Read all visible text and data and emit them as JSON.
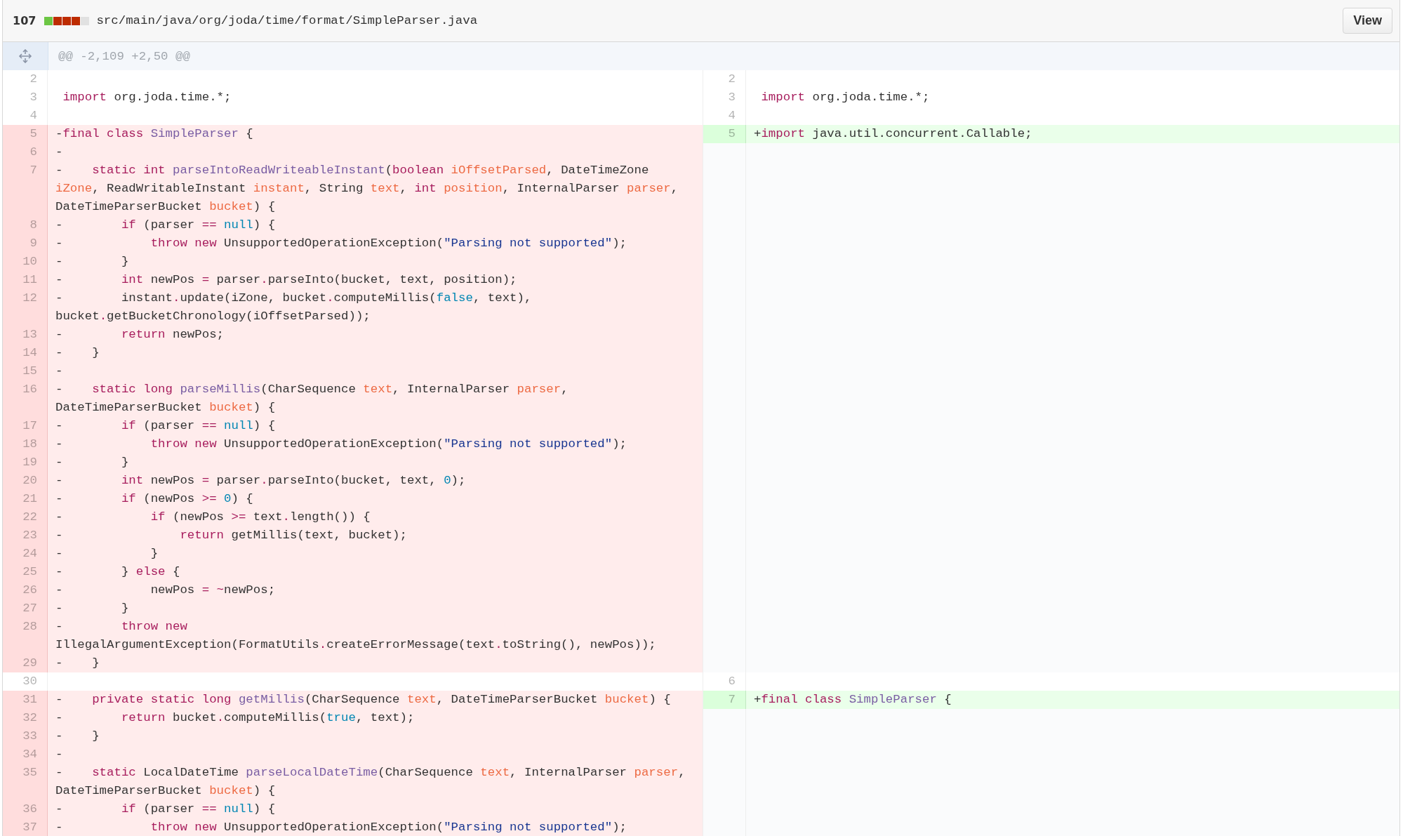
{
  "file_header": {
    "change_count": "107",
    "diffstat": [
      {
        "color": "#6cc644"
      },
      {
        "color": "#bd2c00"
      },
      {
        "color": "#bd2c00"
      },
      {
        "color": "#bd2c00"
      },
      {
        "color": "#e1e1e1"
      }
    ],
    "path": "src/main/java/org/joda/time/format/SimpleParser.java",
    "view_button": "View"
  },
  "hunk": {
    "header": "@@ -2,109 +2,50 @@"
  },
  "rows": [
    {
      "left": {
        "num": "2",
        "kind": "context"
      },
      "right": {
        "num": "2",
        "kind": "context"
      }
    },
    {
      "left": {
        "num": "3",
        "kind": "context",
        "tokens": [
          {
            "kind": "kw",
            "text": " import"
          },
          {
            "kind": "plain",
            "text": " org.joda.time.*;"
          }
        ]
      },
      "right": {
        "num": "3",
        "kind": "context",
        "tokens": [
          {
            "kind": "kw",
            "text": " import"
          },
          {
            "kind": "plain",
            "text": " org.joda.time.*;"
          }
        ]
      }
    },
    {
      "left": {
        "num": "4",
        "kind": "context"
      },
      "right": {
        "num": "4",
        "kind": "context"
      }
    },
    {
      "left": {
        "num": "5",
        "kind": "deleted",
        "tokens": [
          {
            "kind": "plain",
            "text": "-"
          },
          {
            "kind": "kw",
            "text": "final"
          },
          {
            "kind": "kw",
            "text": " class"
          },
          {
            "kind": "fn",
            "text": " SimpleParser"
          },
          {
            "kind": "plain",
            "text": " {"
          }
        ]
      },
      "right": {
        "num": "5",
        "kind": "added",
        "tokens": [
          {
            "kind": "plain",
            "text": "+"
          },
          {
            "kind": "kw",
            "text": "import"
          },
          {
            "kind": "plain",
            "text": " java.util.concurrent.Callable;"
          }
        ]
      }
    },
    {
      "left": {
        "num": "6",
        "kind": "deleted",
        "tokens": [
          {
            "kind": "plain",
            "text": "-"
          }
        ]
      }
    },
    {
      "left": {
        "num": "7",
        "kind": "deleted",
        "tokens": [
          {
            "kind": "plain",
            "text": "-    "
          },
          {
            "kind": "kw",
            "text": "static"
          },
          {
            "kind": "kw",
            "text": " int"
          },
          {
            "kind": "fn",
            "text": " parseIntoReadWriteableInstant"
          },
          {
            "kind": "plain",
            "text": "("
          },
          {
            "kind": "kw",
            "text": "boolean"
          },
          {
            "kind": "param",
            "text": " iOffsetParsed"
          },
          {
            "kind": "plain",
            "text": ", DateTimeZone "
          },
          {
            "kind": "param",
            "text": "iZone"
          },
          {
            "kind": "plain",
            "text": ", ReadWritableInstant "
          },
          {
            "kind": "param",
            "text": "instant"
          },
          {
            "kind": "plain",
            "text": ", String "
          },
          {
            "kind": "param",
            "text": "text"
          },
          {
            "kind": "plain",
            "text": ", "
          },
          {
            "kind": "kw",
            "text": "int"
          },
          {
            "kind": "param",
            "text": " position"
          },
          {
            "kind": "plain",
            "text": ", InternalParser "
          },
          {
            "kind": "param",
            "text": "parser"
          },
          {
            "kind": "plain",
            "text": ", DateTimeParserBucket "
          },
          {
            "kind": "param",
            "text": "bucket"
          },
          {
            "kind": "plain",
            "text": ") {"
          }
        ]
      }
    },
    {
      "left": {
        "num": "8",
        "kind": "deleted",
        "tokens": [
          {
            "kind": "plain",
            "text": "-        "
          },
          {
            "kind": "kw",
            "text": "if"
          },
          {
            "kind": "plain",
            "text": " (parser "
          },
          {
            "kind": "kw",
            "text": "=="
          },
          {
            "kind": "const",
            "text": " null"
          },
          {
            "kind": "plain",
            "text": ") {"
          }
        ]
      }
    },
    {
      "left": {
        "num": "9",
        "kind": "deleted",
        "tokens": [
          {
            "kind": "plain",
            "text": "-            "
          },
          {
            "kind": "kw",
            "text": "throw"
          },
          {
            "kind": "kw",
            "text": " new"
          },
          {
            "kind": "plain",
            "text": " UnsupportedOperationException("
          },
          {
            "kind": "str",
            "text": "\"Parsing not supported\""
          },
          {
            "kind": "plain",
            "text": ");"
          }
        ]
      }
    },
    {
      "left": {
        "num": "10",
        "kind": "deleted",
        "tokens": [
          {
            "kind": "plain",
            "text": "-        }"
          }
        ]
      }
    },
    {
      "left": {
        "num": "11",
        "kind": "deleted",
        "tokens": [
          {
            "kind": "plain",
            "text": "-        "
          },
          {
            "kind": "kw",
            "text": "int"
          },
          {
            "kind": "plain",
            "text": " newPos "
          },
          {
            "kind": "kw",
            "text": "="
          },
          {
            "kind": "plain",
            "text": " parser"
          },
          {
            "kind": "kw",
            "text": "."
          },
          {
            "kind": "plain",
            "text": "parseInto(bucket, text, position);"
          }
        ]
      }
    },
    {
      "left": {
        "num": "12",
        "kind": "deleted",
        "tokens": [
          {
            "kind": "plain",
            "text": "-        instant"
          },
          {
            "kind": "kw",
            "text": "."
          },
          {
            "kind": "plain",
            "text": "update(iZone, bucket"
          },
          {
            "kind": "kw",
            "text": "."
          },
          {
            "kind": "plain",
            "text": "computeMillis("
          },
          {
            "kind": "const",
            "text": "false"
          },
          {
            "kind": "plain",
            "text": ", text), bucket"
          },
          {
            "kind": "kw",
            "text": "."
          },
          {
            "kind": "plain",
            "text": "getBucketChronology(iOffsetParsed));"
          }
        ]
      }
    },
    {
      "left": {
        "num": "13",
        "kind": "deleted",
        "tokens": [
          {
            "kind": "plain",
            "text": "-        "
          },
          {
            "kind": "kw",
            "text": "return"
          },
          {
            "kind": "plain",
            "text": " newPos;"
          }
        ]
      }
    },
    {
      "left": {
        "num": "14",
        "kind": "deleted",
        "tokens": [
          {
            "kind": "plain",
            "text": "-    }"
          }
        ]
      }
    },
    {
      "left": {
        "num": "15",
        "kind": "deleted",
        "tokens": [
          {
            "kind": "plain",
            "text": "-"
          }
        ]
      }
    },
    {
      "left": {
        "num": "16",
        "kind": "deleted",
        "tokens": [
          {
            "kind": "plain",
            "text": "-    "
          },
          {
            "kind": "kw",
            "text": "static"
          },
          {
            "kind": "kw",
            "text": " long"
          },
          {
            "kind": "fn",
            "text": " parseMillis"
          },
          {
            "kind": "plain",
            "text": "(CharSequence "
          },
          {
            "kind": "param",
            "text": "text"
          },
          {
            "kind": "plain",
            "text": ", InternalParser "
          },
          {
            "kind": "param",
            "text": "parser"
          },
          {
            "kind": "plain",
            "text": ", DateTimeParserBucket "
          },
          {
            "kind": "param",
            "text": "bucket"
          },
          {
            "kind": "plain",
            "text": ") {"
          }
        ]
      }
    },
    {
      "left": {
        "num": "17",
        "kind": "deleted",
        "tokens": [
          {
            "kind": "plain",
            "text": "-        "
          },
          {
            "kind": "kw",
            "text": "if"
          },
          {
            "kind": "plain",
            "text": " (parser "
          },
          {
            "kind": "kw",
            "text": "=="
          },
          {
            "kind": "const",
            "text": " null"
          },
          {
            "kind": "plain",
            "text": ") {"
          }
        ]
      }
    },
    {
      "left": {
        "num": "18",
        "kind": "deleted",
        "tokens": [
          {
            "kind": "plain",
            "text": "-            "
          },
          {
            "kind": "kw",
            "text": "throw"
          },
          {
            "kind": "kw",
            "text": " new"
          },
          {
            "kind": "plain",
            "text": " UnsupportedOperationException("
          },
          {
            "kind": "str",
            "text": "\"Parsing not supported\""
          },
          {
            "kind": "plain",
            "text": ");"
          }
        ]
      }
    },
    {
      "left": {
        "num": "19",
        "kind": "deleted",
        "tokens": [
          {
            "kind": "plain",
            "text": "-        }"
          }
        ]
      }
    },
    {
      "left": {
        "num": "20",
        "kind": "deleted",
        "tokens": [
          {
            "kind": "plain",
            "text": "-        "
          },
          {
            "kind": "kw",
            "text": "int"
          },
          {
            "kind": "plain",
            "text": " newPos "
          },
          {
            "kind": "kw",
            "text": "="
          },
          {
            "kind": "plain",
            "text": " parser"
          },
          {
            "kind": "kw",
            "text": "."
          },
          {
            "kind": "plain",
            "text": "parseInto(bucket, text, "
          },
          {
            "kind": "const",
            "text": "0"
          },
          {
            "kind": "plain",
            "text": ");"
          }
        ]
      }
    },
    {
      "left": {
        "num": "21",
        "kind": "deleted",
        "tokens": [
          {
            "kind": "plain",
            "text": "-        "
          },
          {
            "kind": "kw",
            "text": "if"
          },
          {
            "kind": "plain",
            "text": " (newPos "
          },
          {
            "kind": "kw",
            "text": ">="
          },
          {
            "kind": "const",
            "text": " 0"
          },
          {
            "kind": "plain",
            "text": ") {"
          }
        ]
      }
    },
    {
      "left": {
        "num": "22",
        "kind": "deleted",
        "tokens": [
          {
            "kind": "plain",
            "text": "-            "
          },
          {
            "kind": "kw",
            "text": "if"
          },
          {
            "kind": "plain",
            "text": " (newPos "
          },
          {
            "kind": "kw",
            "text": ">="
          },
          {
            "kind": "plain",
            "text": " text"
          },
          {
            "kind": "kw",
            "text": "."
          },
          {
            "kind": "plain",
            "text": "length()) {"
          }
        ]
      }
    },
    {
      "left": {
        "num": "23",
        "kind": "deleted",
        "tokens": [
          {
            "kind": "plain",
            "text": "-                "
          },
          {
            "kind": "kw",
            "text": "return"
          },
          {
            "kind": "plain",
            "text": " getMillis(text, bucket);"
          }
        ]
      }
    },
    {
      "left": {
        "num": "24",
        "kind": "deleted",
        "tokens": [
          {
            "kind": "plain",
            "text": "-            }"
          }
        ]
      }
    },
    {
      "left": {
        "num": "25",
        "kind": "deleted",
        "tokens": [
          {
            "kind": "plain",
            "text": "-        } "
          },
          {
            "kind": "kw",
            "text": "else"
          },
          {
            "kind": "plain",
            "text": " {"
          }
        ]
      }
    },
    {
      "left": {
        "num": "26",
        "kind": "deleted",
        "tokens": [
          {
            "kind": "plain",
            "text": "-            newPos "
          },
          {
            "kind": "kw",
            "text": "="
          },
          {
            "kind": "kw",
            "text": " ~"
          },
          {
            "kind": "plain",
            "text": "newPos;"
          }
        ]
      }
    },
    {
      "left": {
        "num": "27",
        "kind": "deleted",
        "tokens": [
          {
            "kind": "plain",
            "text": "-        }"
          }
        ]
      }
    },
    {
      "left": {
        "num": "28",
        "kind": "deleted",
        "tokens": [
          {
            "kind": "plain",
            "text": "-        "
          },
          {
            "kind": "kw",
            "text": "throw"
          },
          {
            "kind": "kw",
            "text": " new"
          },
          {
            "kind": "plain",
            "text": " IllegalArgumentException(FormatUtils"
          },
          {
            "kind": "kw",
            "text": "."
          },
          {
            "kind": "plain",
            "text": "createErrorMessage(text"
          },
          {
            "kind": "kw",
            "text": "."
          },
          {
            "kind": "plain",
            "text": "toString(), newPos));"
          }
        ]
      }
    },
    {
      "left": {
        "num": "29",
        "kind": "deleted",
        "tokens": [
          {
            "kind": "plain",
            "text": "-    }"
          }
        ]
      }
    },
    {
      "left": {
        "num": "30",
        "kind": "context"
      },
      "right": {
        "num": "6",
        "kind": "context"
      }
    },
    {
      "left": {
        "num": "31",
        "kind": "deleted",
        "tokens": [
          {
            "kind": "plain",
            "text": "-    "
          },
          {
            "kind": "kw",
            "text": "private"
          },
          {
            "kind": "kw",
            "text": " static"
          },
          {
            "kind": "kw",
            "text": " long"
          },
          {
            "kind": "fn",
            "text": " getMillis"
          },
          {
            "kind": "plain",
            "text": "(CharSequence "
          },
          {
            "kind": "param",
            "text": "text"
          },
          {
            "kind": "plain",
            "text": ", DateTimeParserBucket "
          },
          {
            "kind": "param",
            "text": "bucket"
          },
          {
            "kind": "plain",
            "text": ") {"
          }
        ]
      },
      "right": {
        "num": "7",
        "kind": "added",
        "tokens": [
          {
            "kind": "plain",
            "text": "+"
          },
          {
            "kind": "kw",
            "text": "final"
          },
          {
            "kind": "kw",
            "text": " class"
          },
          {
            "kind": "fn",
            "text": " SimpleParser"
          },
          {
            "kind": "plain",
            "text": " {"
          }
        ]
      }
    },
    {
      "left": {
        "num": "32",
        "kind": "deleted",
        "tokens": [
          {
            "kind": "plain",
            "text": "-        "
          },
          {
            "kind": "kw",
            "text": "return"
          },
          {
            "kind": "plain",
            "text": " bucket"
          },
          {
            "kind": "kw",
            "text": "."
          },
          {
            "kind": "plain",
            "text": "computeMillis("
          },
          {
            "kind": "const",
            "text": "true"
          },
          {
            "kind": "plain",
            "text": ", text);"
          }
        ]
      }
    },
    {
      "left": {
        "num": "33",
        "kind": "deleted",
        "tokens": [
          {
            "kind": "plain",
            "text": "-    }"
          }
        ]
      }
    },
    {
      "left": {
        "num": "34",
        "kind": "deleted",
        "tokens": [
          {
            "kind": "plain",
            "text": "-"
          }
        ]
      }
    },
    {
      "left": {
        "num": "35",
        "kind": "deleted",
        "tokens": [
          {
            "kind": "plain",
            "text": "-    "
          },
          {
            "kind": "kw",
            "text": "static"
          },
          {
            "kind": "plain",
            "text": " LocalDateTime "
          },
          {
            "kind": "fn",
            "text": "parseLocalDateTime"
          },
          {
            "kind": "plain",
            "text": "(CharSequence "
          },
          {
            "kind": "param",
            "text": "text"
          },
          {
            "kind": "plain",
            "text": ", InternalParser "
          },
          {
            "kind": "param",
            "text": "parser"
          },
          {
            "kind": "plain",
            "text": ", DateTimeParserBucket "
          },
          {
            "kind": "param",
            "text": "bucket"
          },
          {
            "kind": "plain",
            "text": ") {"
          }
        ]
      }
    },
    {
      "left": {
        "num": "36",
        "kind": "deleted",
        "tokens": [
          {
            "kind": "plain",
            "text": "-        "
          },
          {
            "kind": "kw",
            "text": "if"
          },
          {
            "kind": "plain",
            "text": " (parser "
          },
          {
            "kind": "kw",
            "text": "=="
          },
          {
            "kind": "const",
            "text": " null"
          },
          {
            "kind": "plain",
            "text": ") {"
          }
        ]
      }
    },
    {
      "left": {
        "num": "37",
        "kind": "deleted",
        "tokens": [
          {
            "kind": "plain",
            "text": "-            "
          },
          {
            "kind": "kw",
            "text": "throw"
          },
          {
            "kind": "kw",
            "text": " new"
          },
          {
            "kind": "plain",
            "text": " UnsupportedOperationException("
          },
          {
            "kind": "str",
            "text": "\"Parsing not supported\""
          },
          {
            "kind": "plain",
            "text": ");"
          }
        ]
      }
    }
  ]
}
